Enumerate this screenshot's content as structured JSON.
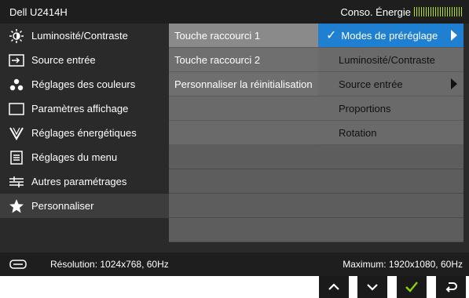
{
  "osd": {
    "model": "Dell U2414H",
    "energy_label": "Conso. Énergie",
    "energy_level": 1.0,
    "sidebar": [
      {
        "label": "Luminosité/Contraste",
        "icon": "brightness-icon"
      },
      {
        "label": "Source entrée",
        "icon": "input-source-icon"
      },
      {
        "label": "Réglages des couleurs",
        "icon": "color-dots-icon"
      },
      {
        "label": "Paramètres affichage",
        "icon": "display-icon"
      },
      {
        "label": "Réglages énergétiques",
        "icon": "energy-icon"
      },
      {
        "label": "Réglages du menu",
        "icon": "menu-icon"
      },
      {
        "label": "Autres paramétrages",
        "icon": "other-settings-icon"
      },
      {
        "label": "Personnaliser",
        "icon": "star-icon",
        "active": true
      }
    ],
    "middle": [
      {
        "label": "Touche raccourci 1",
        "selected": true
      },
      {
        "label": "Touche raccourci 2"
      },
      {
        "label": "Personnaliser la réinitialisation"
      },
      {
        "label": ""
      },
      {
        "label": ""
      }
    ],
    "right": [
      {
        "label": "Modes de préréglage",
        "selected": true,
        "checked": true,
        "submenu": true
      },
      {
        "label": "Luminosité/Contraste"
      },
      {
        "label": "Source entrée",
        "submenu": true
      },
      {
        "label": "Proportions"
      },
      {
        "label": "Rotation"
      }
    ],
    "status": {
      "resolution": "Résolution: 1024x768, 60Hz",
      "maximum": "Maximum: 1920x1080, 60Hz"
    },
    "keys": [
      "up-icon",
      "down-icon",
      "check-icon",
      "back-icon"
    ],
    "colors": {
      "highlight": "#1f7fd1",
      "energy": "#b6e21a",
      "check": "#8fd400"
    }
  }
}
